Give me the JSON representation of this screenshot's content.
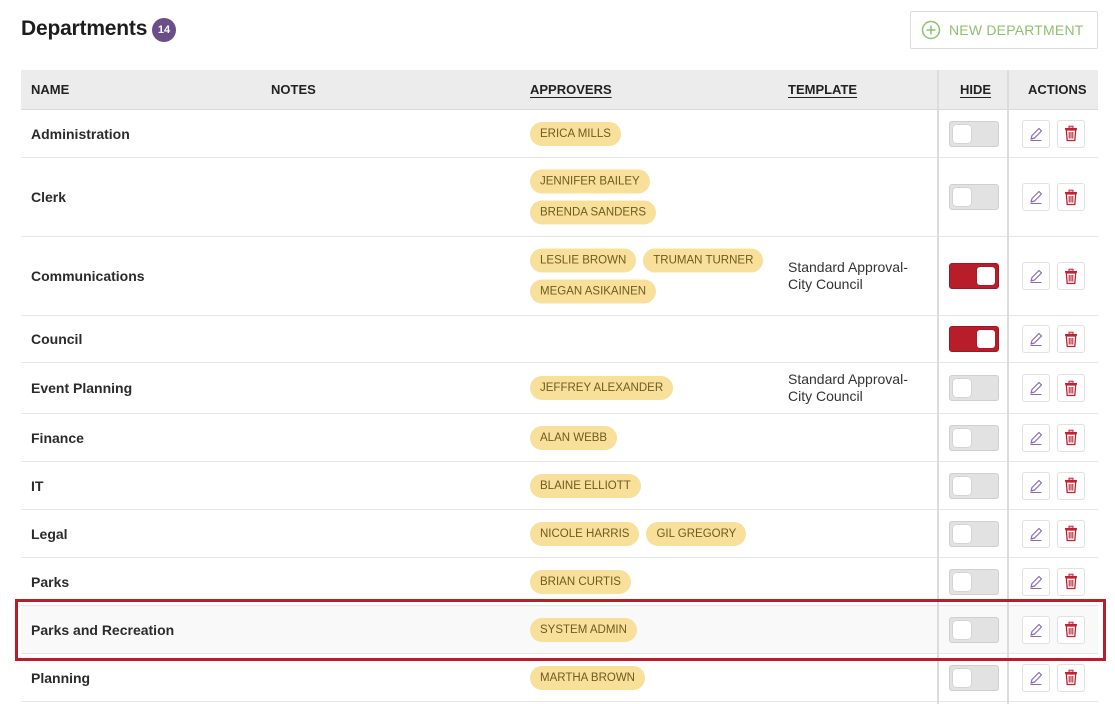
{
  "header": {
    "title": "Departments",
    "count": "14",
    "new_button_label": "NEW DEPARTMENT"
  },
  "columns": {
    "name": "NAME",
    "notes": "NOTES",
    "approvers": "APPROVERS",
    "template": "TEMPLATE",
    "hide": "HIDE",
    "actions": "ACTIONS"
  },
  "rows": [
    {
      "name": "Administration",
      "approvers": [
        "ERICA MILLS"
      ],
      "template": "",
      "hidden": false
    },
    {
      "name": "Clerk",
      "approvers": [
        "JENNIFER BAILEY",
        "BRENDA SANDERS"
      ],
      "template": "",
      "hidden": false
    },
    {
      "name": "Communications",
      "approvers": [
        "LESLIE BROWN",
        "TRUMAN TURNER",
        "MEGAN ASIKAINEN"
      ],
      "template": "Standard Approval- City Council",
      "hidden": true
    },
    {
      "name": "Council",
      "approvers": [],
      "template": "",
      "hidden": true
    },
    {
      "name": "Event Planning",
      "approvers": [
        "JEFFREY ALEXANDER"
      ],
      "template": "Standard Approval- City Council",
      "hidden": false
    },
    {
      "name": "Finance",
      "approvers": [
        "ALAN WEBB"
      ],
      "template": "",
      "hidden": false
    },
    {
      "name": "IT",
      "approvers": [
        "BLAINE ELLIOTT"
      ],
      "template": "",
      "hidden": false
    },
    {
      "name": "Legal",
      "approvers": [
        "NICOLE HARRIS",
        "GIL GREGORY"
      ],
      "template": "",
      "hidden": false
    },
    {
      "name": "Parks",
      "approvers": [
        "BRIAN CURTIS"
      ],
      "template": "",
      "hidden": false
    },
    {
      "name": "Parks and Recreation",
      "approvers": [
        "SYSTEM ADMIN"
      ],
      "template": "",
      "hidden": false,
      "highlighted": true
    },
    {
      "name": "Planning",
      "approvers": [
        "MARTHA BROWN"
      ],
      "template": "",
      "hidden": false
    }
  ],
  "colors": {
    "accent_purple": "#6a4e89",
    "toggle_on": "#b81d2a",
    "chip_bg": "#f8e09b",
    "new_button_green": "#8cc26d",
    "highlight_outline": "#b81d2a"
  },
  "icons": {
    "new_button": "plus-circle-icon",
    "edit": "pencil-icon",
    "delete": "trash-icon"
  }
}
